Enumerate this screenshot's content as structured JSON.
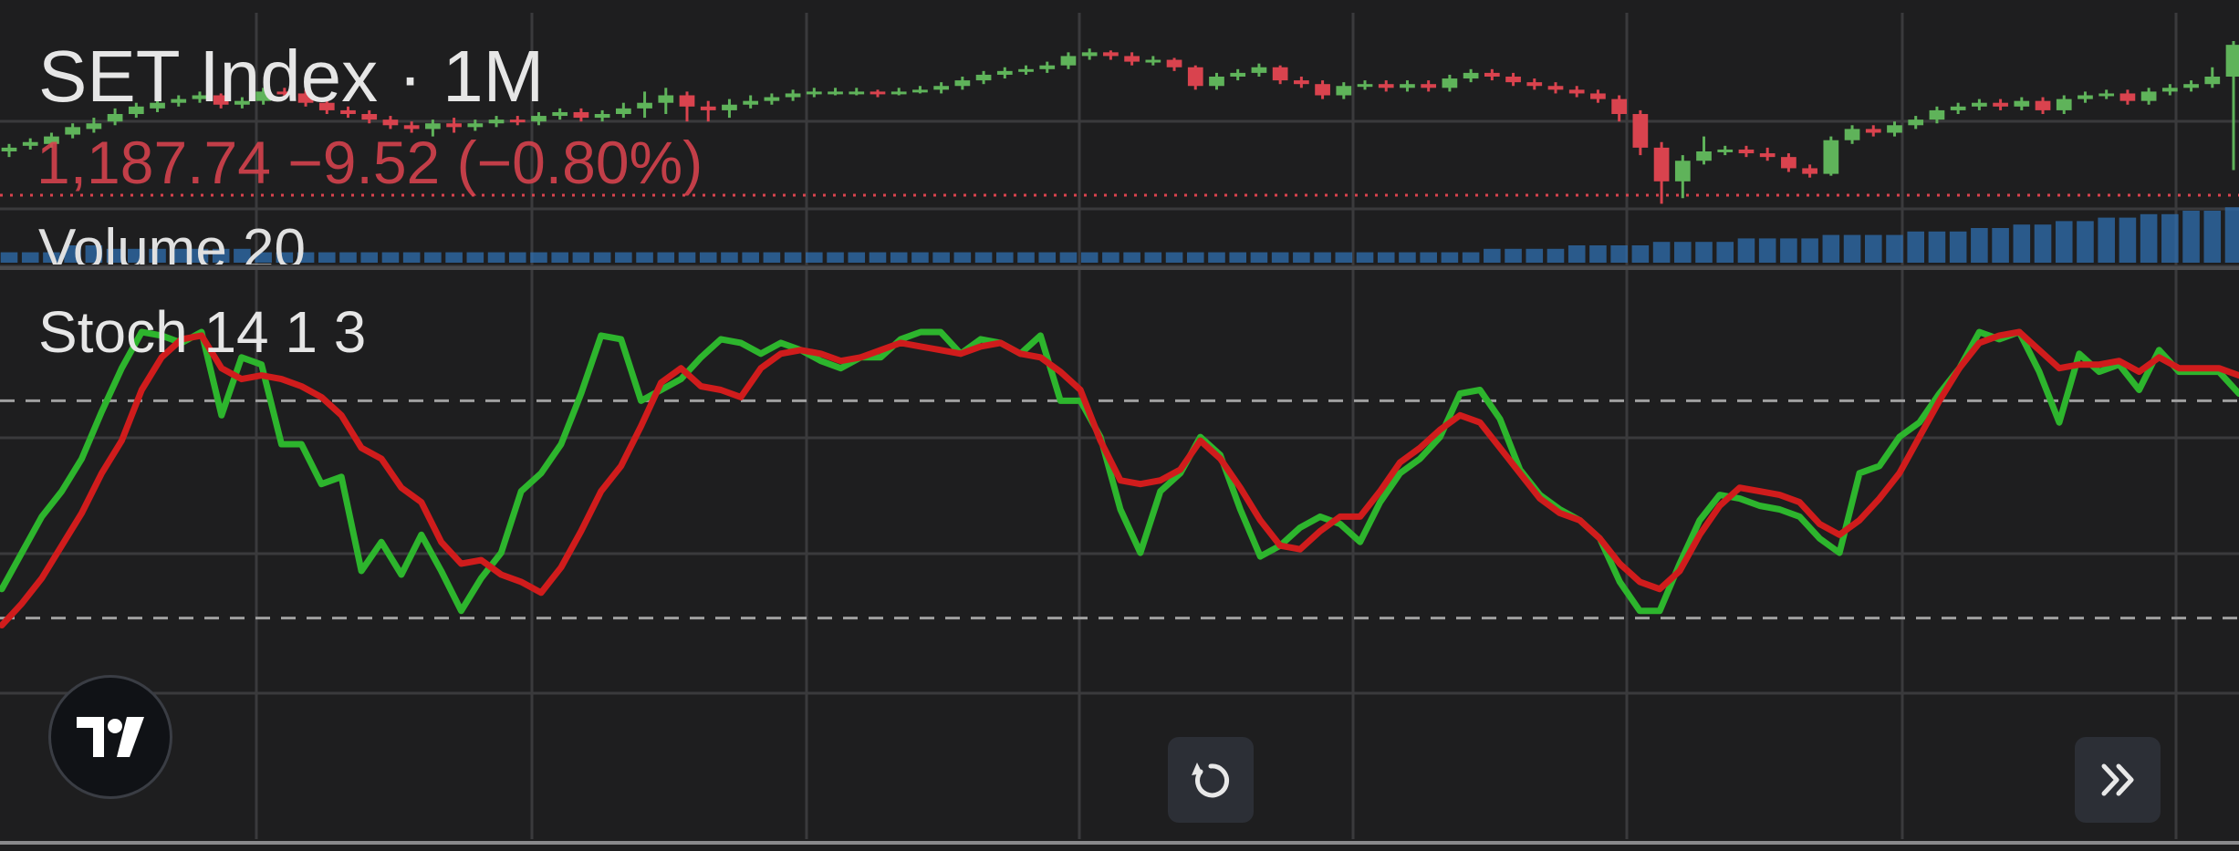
{
  "header": {
    "title": "SET Index · 1M",
    "price_line": "1,187.74 −9.52 (−0.80%)",
    "volume_label": "Volume 20",
    "stoch_label": "Stoch 14 1 3"
  },
  "icons": {
    "logo": "tradingview-logo-icon",
    "reset": "reset-rotate-icon",
    "scroll": "double-chevron-right-icon"
  },
  "colors": {
    "background": "#1e1e1f",
    "up": "#5fb35a",
    "down": "#d9434e",
    "volume": "#2f6fb0",
    "stoch_k": "#2db52d",
    "stoch_d": "#d01c1c",
    "grid": "#3a3a3c"
  },
  "chart_data": [
    {
      "type": "candlestick",
      "current_price": 1187.74,
      "ylim": [
        0,
        100
      ],
      "candles": [
        [
          40,
          42,
          44,
          37
        ],
        [
          43,
          45,
          47,
          41
        ],
        [
          44,
          48,
          50,
          42
        ],
        [
          49,
          53,
          55,
          47
        ],
        [
          52,
          55,
          58,
          50
        ],
        [
          56,
          60,
          63,
          54
        ],
        [
          60,
          64,
          66,
          58
        ],
        [
          63,
          66,
          68,
          61
        ],
        [
          66,
          68,
          70,
          64
        ],
        [
          68,
          70,
          72,
          66
        ],
        [
          70,
          65,
          71,
          63
        ],
        [
          65,
          67,
          69,
          63
        ],
        [
          67,
          72,
          74,
          65
        ],
        [
          72,
          71,
          74,
          68
        ],
        [
          71,
          66,
          73,
          64
        ],
        [
          66,
          62,
          68,
          60
        ],
        [
          62,
          60,
          64,
          58
        ],
        [
          60,
          57,
          62,
          55
        ],
        [
          57,
          54,
          59,
          52
        ],
        [
          54,
          52,
          56,
          50
        ],
        [
          52,
          55,
          57,
          48
        ],
        [
          55,
          53,
          58,
          50
        ],
        [
          53,
          55,
          57,
          51
        ],
        [
          55,
          57,
          59,
          53
        ],
        [
          57,
          56,
          59,
          54
        ],
        [
          56,
          59,
          61,
          54
        ],
        [
          59,
          61,
          63,
          57
        ],
        [
          61,
          58,
          63,
          56
        ],
        [
          58,
          60,
          62,
          56
        ],
        [
          60,
          63,
          66,
          58
        ],
        [
          63,
          66,
          72,
          58
        ],
        [
          66,
          70,
          74,
          60
        ],
        [
          70,
          64,
          72,
          56
        ],
        [
          64,
          62,
          67,
          56
        ],
        [
          62,
          65,
          68,
          58
        ],
        [
          65,
          67,
          70,
          63
        ],
        [
          67,
          69,
          71,
          65
        ],
        [
          69,
          71,
          73,
          67
        ],
        [
          71,
          72,
          74,
          69
        ],
        [
          72,
          72,
          74,
          70
        ],
        [
          72,
          72,
          74,
          70
        ],
        [
          72,
          71,
          73,
          69
        ],
        [
          71,
          72,
          74,
          70
        ],
        [
          72,
          73,
          75,
          71
        ],
        [
          73,
          75,
          77,
          71
        ],
        [
          75,
          78,
          80,
          73
        ],
        [
          78,
          81,
          83,
          76
        ],
        [
          81,
          83,
          85,
          79
        ],
        [
          83,
          84,
          86,
          81
        ],
        [
          84,
          86,
          88,
          82
        ],
        [
          86,
          91,
          93,
          84
        ],
        [
          91,
          93,
          95,
          89
        ],
        [
          93,
          91,
          94,
          89
        ],
        [
          91,
          88,
          93,
          86
        ],
        [
          88,
          89,
          91,
          86
        ],
        [
          89,
          85,
          90,
          83
        ],
        [
          85,
          75,
          86,
          73
        ],
        [
          75,
          80,
          82,
          73
        ],
        [
          80,
          82,
          84,
          78
        ],
        [
          82,
          85,
          87,
          80
        ],
        [
          85,
          78,
          86,
          76
        ],
        [
          78,
          76,
          80,
          74
        ],
        [
          76,
          70,
          78,
          68
        ],
        [
          70,
          75,
          77,
          68
        ],
        [
          75,
          76,
          78,
          73
        ],
        [
          76,
          74,
          78,
          72
        ],
        [
          74,
          76,
          78,
          72
        ],
        [
          76,
          74,
          78,
          72
        ],
        [
          74,
          79,
          81,
          72
        ],
        [
          79,
          82,
          84,
          77
        ],
        [
          82,
          80,
          84,
          78
        ],
        [
          80,
          77,
          82,
          75
        ],
        [
          77,
          75,
          79,
          73
        ],
        [
          75,
          73,
          77,
          71
        ],
        [
          73,
          71,
          75,
          69
        ],
        [
          71,
          68,
          73,
          66
        ],
        [
          68,
          60,
          70,
          56
        ],
        [
          60,
          42,
          62,
          38
        ],
        [
          42,
          24,
          45,
          12
        ],
        [
          24,
          35,
          38,
          15
        ],
        [
          35,
          40,
          48,
          33
        ],
        [
          40,
          41,
          43,
          38
        ],
        [
          41,
          39,
          43,
          37
        ],
        [
          39,
          37,
          42,
          35
        ],
        [
          37,
          31,
          39,
          29
        ],
        [
          31,
          28,
          33,
          26
        ],
        [
          28,
          46,
          48,
          27
        ],
        [
          46,
          52,
          54,
          44
        ],
        [
          52,
          50,
          54,
          48
        ],
        [
          50,
          54,
          56,
          48
        ],
        [
          54,
          57,
          59,
          52
        ],
        [
          57,
          62,
          64,
          55
        ],
        [
          62,
          64,
          66,
          60
        ],
        [
          64,
          66,
          68,
          62
        ],
        [
          66,
          64,
          68,
          62
        ],
        [
          64,
          67,
          69,
          62
        ],
        [
          67,
          62,
          69,
          60
        ],
        [
          62,
          68,
          70,
          60
        ],
        [
          68,
          70,
          72,
          66
        ],
        [
          70,
          71,
          73,
          68
        ],
        [
          71,
          67,
          73,
          65
        ],
        [
          67,
          72,
          74,
          65
        ],
        [
          72,
          74,
          76,
          70
        ],
        [
          74,
          76,
          78,
          72
        ],
        [
          76,
          80,
          85,
          74
        ],
        [
          80,
          97,
          99,
          30
        ]
      ],
      "volume": [
        3,
        3,
        3,
        5,
        5,
        4,
        4,
        4,
        4,
        4,
        4,
        4,
        3,
        3,
        3,
        3,
        3,
        3,
        3,
        3,
        3,
        3,
        3,
        3,
        3,
        3,
        3,
        3,
        3,
        3,
        3,
        3,
        3,
        3,
        3,
        3,
        3,
        3,
        3,
        3,
        3,
        3,
        3,
        3,
        3,
        3,
        3,
        3,
        3,
        3,
        3,
        3,
        3,
        3,
        3,
        3,
        3,
        3,
        3,
        3,
        3,
        3,
        3,
        3,
        3,
        3,
        3,
        3,
        3,
        3,
        4,
        4,
        4,
        4,
        5,
        5,
        5,
        5,
        6,
        6,
        6,
        6,
        7,
        7,
        7,
        7,
        8,
        8,
        8,
        8,
        9,
        9,
        9,
        10,
        10,
        11,
        11,
        12,
        12,
        13,
        13,
        14,
        14,
        15,
        15,
        16
      ]
    },
    {
      "type": "line",
      "title": "Stoch 14 1 3",
      "ylim": [
        0,
        100
      ],
      "levels": [
        80,
        20
      ],
      "series": [
        {
          "values": [
            28,
            38,
            48,
            55,
            64,
            77,
            89,
            99,
            98,
            96,
            99,
            76,
            92,
            90,
            68,
            68,
            57,
            59,
            33,
            41,
            32,
            43,
            33,
            22,
            31,
            38,
            55,
            60,
            68,
            82,
            98,
            97,
            80,
            83,
            86,
            92,
            97,
            96,
            93,
            96,
            94,
            91,
            89,
            92,
            92,
            97,
            99,
            99,
            93,
            97,
            96,
            93,
            98,
            80,
            80,
            70,
            50,
            38,
            55,
            60,
            70,
            65,
            50,
            37,
            40,
            45,
            48,
            46,
            41,
            52,
            60,
            64,
            70,
            82,
            83,
            75,
            61,
            54,
            50,
            47,
            42,
            30,
            22,
            22,
            35,
            47,
            54,
            53,
            51,
            50,
            48,
            42,
            38,
            60,
            62,
            70,
            74,
            82,
            89,
            99,
            97,
            99,
            88,
            74,
            93,
            88,
            90,
            83,
            94,
            88,
            88,
            88,
            82
          ]
        },
        {
          "values": [
            18,
            24,
            31,
            40,
            49,
            60,
            69,
            83,
            92,
            97,
            98,
            89,
            86,
            87,
            86,
            84,
            81,
            76,
            67,
            64,
            56,
            52,
            41,
            35,
            36,
            32,
            30,
            27,
            34,
            44,
            55,
            62,
            73,
            85,
            89,
            84,
            83,
            81,
            89,
            93,
            94,
            93,
            91,
            92,
            94,
            96,
            95,
            94,
            93,
            95,
            96,
            93,
            92,
            88,
            83,
            69,
            58,
            57,
            58,
            61,
            69,
            64,
            56,
            47,
            40,
            39,
            44,
            48,
            48,
            55,
            63,
            67,
            72,
            76,
            74,
            67,
            60,
            53,
            49,
            47,
            42,
            35,
            30,
            28,
            33,
            43,
            51,
            56,
            55,
            54,
            52,
            46,
            43,
            47,
            53,
            60,
            70,
            80,
            89,
            96,
            98,
            99,
            94,
            89,
            90,
            90,
            91,
            88,
            92,
            89,
            89,
            89,
            87
          ]
        }
      ]
    }
  ]
}
